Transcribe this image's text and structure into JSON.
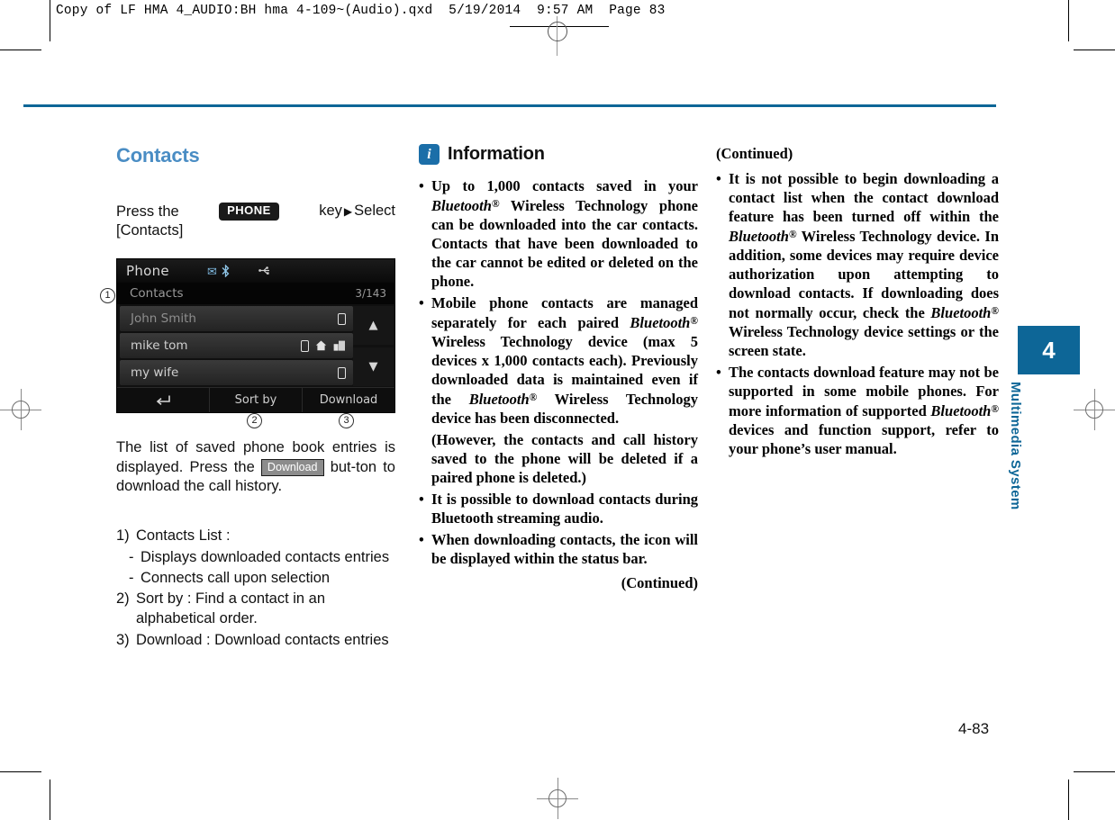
{
  "prepress": {
    "slug": "Copy of LF HMA 4_AUDIO:BH hma 4-109~(Audio).qxd  5/19/2014  9:57 AM  Page 83"
  },
  "left_column": {
    "section_title": "Contacts",
    "instruction": {
      "pre": "Press   the",
      "key_badge": "PHONE",
      "arrow": "▶",
      "post_key": "key",
      "post": "Select",
      "line2": "[Contacts]"
    },
    "device_screenshot": {
      "status_bar": {
        "title": "Phone",
        "bluetooth_icon": "bluetooth-icon",
        "usb_icon": "usb-icon"
      },
      "sub_bar": {
        "label": "Contacts",
        "count": "3/143"
      },
      "rows": [
        {
          "name": "John Smith",
          "icons": [
            "mobile-icon"
          ]
        },
        {
          "name": "mike tom",
          "icons": [
            "mobile-icon",
            "home-icon",
            "office-icon"
          ]
        },
        {
          "name": "my wife",
          "icons": [
            "mobile-icon"
          ]
        }
      ],
      "scroll_up": "▲",
      "scroll_down": "▼",
      "footer": {
        "back": "↰",
        "sort_by": "Sort by",
        "download": "Download"
      },
      "callouts": [
        "1",
        "2",
        "3"
      ]
    },
    "paragraph": {
      "part1": "The list of saved phone book entries is displayed. Press the",
      "badge": "Download",
      "part2": "but-ton to download the call history."
    },
    "numbered_list": [
      {
        "num": "1)",
        "text": "Contacts List :",
        "subs": [
          "Displays   downloaded   contacts entries",
          "Connects call upon selection"
        ]
      },
      {
        "num": "2)",
        "text": "Sort by : Find a contact in an alphabetical order.",
        "subs": []
      },
      {
        "num": "3)",
        "text": "Download  :  Download  contacts entries",
        "subs": []
      }
    ]
  },
  "middle_column": {
    "info_title": "Information",
    "info_icon": "i",
    "bullets": [
      {
        "type": "bullet",
        "segments": [
          {
            "t": "Up to 1,000 contacts saved in your "
          },
          {
            "t": "Bluetooth",
            "i": true
          },
          {
            "t": "®",
            "sup": true
          },
          {
            "t": " Wireless Technology phone can be downloaded into the car contacts. Contacts that have been downloaded to the car cannot be edited or deleted on the phone."
          }
        ]
      },
      {
        "type": "bullet",
        "segments": [
          {
            "t": "Mobile phone contacts are managed separately for each paired "
          },
          {
            "t": "Bluetooth",
            "i": true
          },
          {
            "t": "®",
            "sup": true
          },
          {
            "t": " Wireless Technology device (max 5 devices x 1,000 contacts each). Previously downloaded data is maintained even if the "
          },
          {
            "t": "Bluetooth",
            "i": true
          },
          {
            "t": "®",
            "sup": true
          },
          {
            "t": " Wireless Technology device has been disconnected."
          }
        ]
      },
      {
        "type": "plain",
        "segments": [
          {
            "t": "(However, the contacts and call history saved to the phone will be deleted if a paired phone is deleted.)"
          }
        ]
      },
      {
        "type": "bullet",
        "segments": [
          {
            "t": "It is possible to download contacts during Bluetooth streaming audio."
          }
        ]
      },
      {
        "type": "bullet",
        "segments": [
          {
            "t": "When downloading contacts, the icon will be displayed within the status bar."
          }
        ]
      }
    ],
    "continued": "(Continued)"
  },
  "right_column": {
    "continued_header": "(Continued)",
    "bullets": [
      {
        "type": "bullet",
        "segments": [
          {
            "t": "It is not possible to begin downloading a contact list when the contact download feature has been turned off within the "
          },
          {
            "t": "Bluetooth",
            "i": true
          },
          {
            "t": "®",
            "sup": true
          },
          {
            "t": " Wireless Technology device. In addition, some devices may require device authorization upon attempting to download contacts. If downloading does not normally occur, check the "
          },
          {
            "t": "Bluetooth",
            "i": true
          },
          {
            "t": "®",
            "sup": true
          },
          {
            "t": " Wireless Technology device settings or the screen state."
          }
        ]
      },
      {
        "type": "bullet",
        "segments": [
          {
            "t": "The contacts download feature may not be supported in some mobile phones. For more information of supported "
          },
          {
            "t": "Bluetooth",
            "i": true
          },
          {
            "t": "®",
            "sup": true
          },
          {
            "t": " devices and function support, refer to your phone’s user manual."
          }
        ]
      }
    ]
  },
  "chapter_tab": {
    "number": "4",
    "label": "Multimedia System"
  },
  "footer": {
    "page_number": "4-83"
  },
  "colors": {
    "accent_blue": "#0d6697",
    "title_blue": "#4a8dc4",
    "info_icon_blue": "#1b6ea8"
  }
}
